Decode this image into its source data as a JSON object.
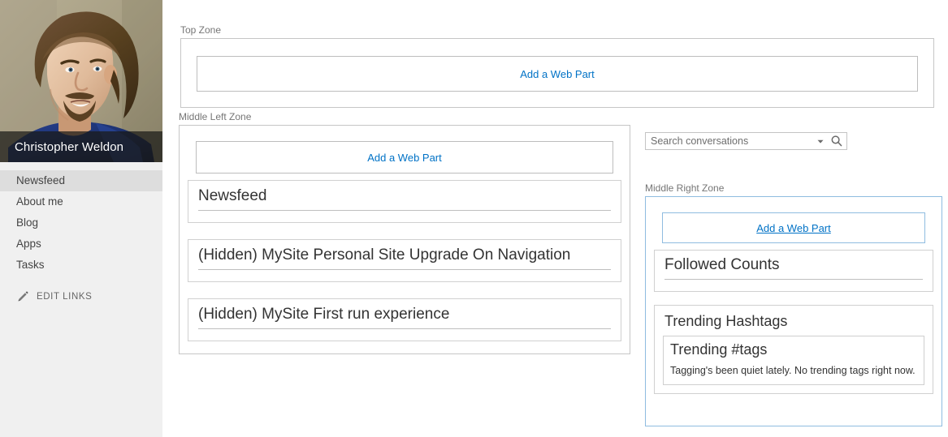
{
  "sidebar": {
    "profile": {
      "name": "Christopher Weldon",
      "photo_alt": "Portrait photo of Christopher Weldon"
    },
    "nav_items": [
      {
        "label": "Newsfeed",
        "selected": true
      },
      {
        "label": "About me",
        "selected": false
      },
      {
        "label": "Blog",
        "selected": false
      },
      {
        "label": "Apps",
        "selected": false
      },
      {
        "label": "Tasks",
        "selected": false
      }
    ],
    "edit_links": {
      "label": "EDIT LINKS",
      "icon": "pencil-icon"
    }
  },
  "top_zone": {
    "label": "Top Zone",
    "add_web_part": "Add a Web Part"
  },
  "middle_left_zone": {
    "label": "Middle Left Zone",
    "add_web_part": "Add a Web Part",
    "web_parts": [
      {
        "title": "Newsfeed"
      },
      {
        "title": "(Hidden) MySite Personal Site Upgrade On Navigation"
      },
      {
        "title": "(Hidden) MySite First run experience"
      }
    ]
  },
  "search": {
    "placeholder": "Search conversations",
    "value": "",
    "caret_icon": "chevron-down-icon",
    "search_icon": "search-icon"
  },
  "middle_right_zone": {
    "label": "Middle Right Zone",
    "add_web_part": "Add a Web Part",
    "web_parts": [
      {
        "title": "Followed Counts"
      },
      {
        "title": "Trending Hashtags",
        "inner_title": "Trending #tags",
        "inner_text": "Tagging's been quiet lately. No trending tags right now."
      }
    ]
  },
  "colors": {
    "link_blue": "#0072c6",
    "zone_border_gray": "#c6c6c6",
    "zone_border_highlight": "#8fbce0",
    "sidebar_bg": "#f0f0f0",
    "sidebar_selected_bg": "#dddddd",
    "name_bar_bg": "rgba(25,25,22,0.72)"
  }
}
